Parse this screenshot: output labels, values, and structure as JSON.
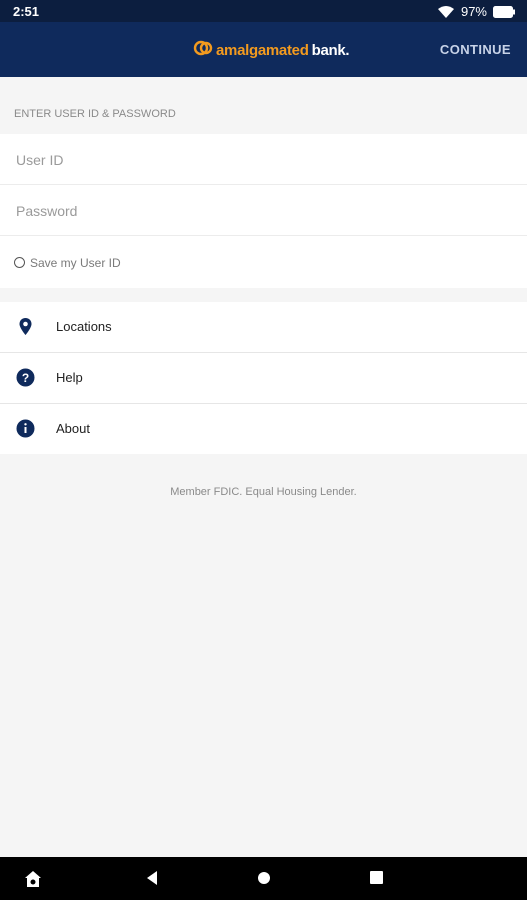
{
  "status_bar": {
    "time": "2:51",
    "battery": "97%"
  },
  "header": {
    "logo_part_1": "amalgamated",
    "logo_part_2": "bank.",
    "continue_label": "CONTINUE"
  },
  "login": {
    "section_label": "ENTER USER ID & PASSWORD",
    "user_id_placeholder": "User ID",
    "password_placeholder": "Password",
    "save_label": "Save my User ID"
  },
  "menu": {
    "items": [
      {
        "label": "Locations",
        "icon": "location-pin-icon"
      },
      {
        "label": "Help",
        "icon": "help-icon"
      },
      {
        "label": "About",
        "icon": "info-icon"
      }
    ]
  },
  "footer": {
    "fdic": "Member FDIC. Equal Housing Lender."
  },
  "colors": {
    "header": "#0f2a5c",
    "status": "#0c1e3f",
    "brand_orange": "#f29a1f",
    "icon_navy": "#0f2a5c"
  }
}
